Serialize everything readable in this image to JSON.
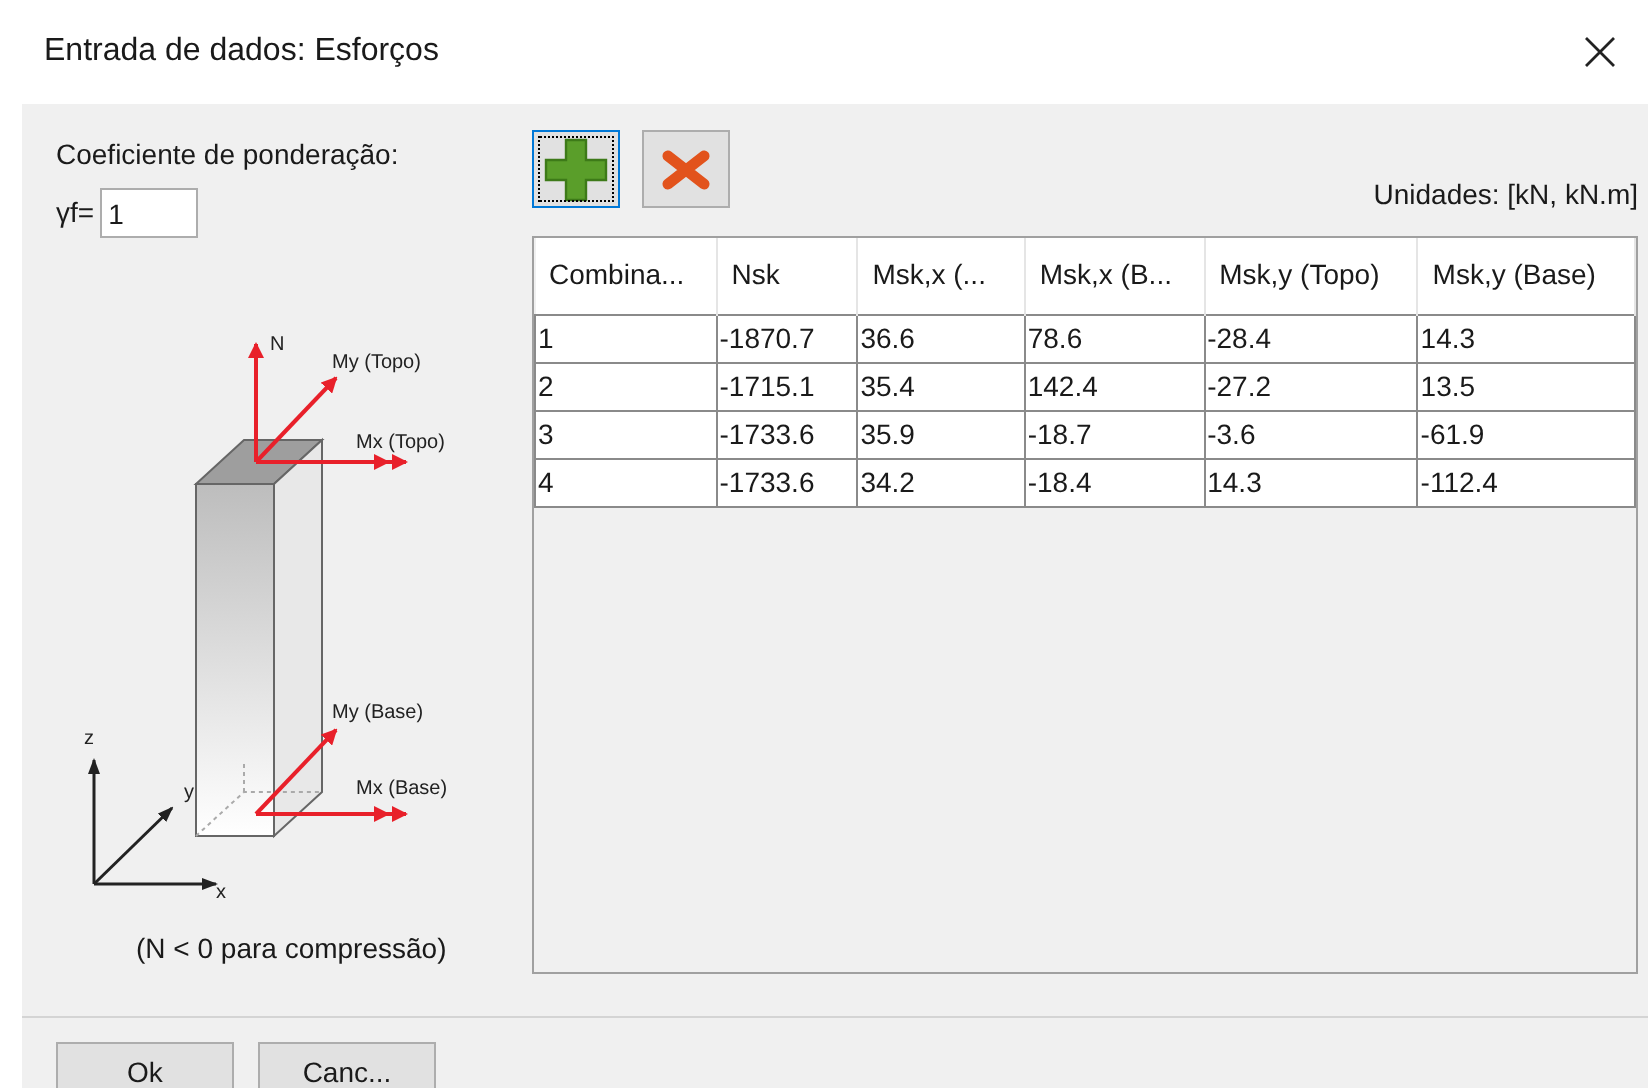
{
  "window": {
    "title": "Entrada de dados: Esforços"
  },
  "weighting": {
    "label": "Coeficiente de ponderação:",
    "field_label": "γf=",
    "value": "1"
  },
  "diagram": {
    "labels": [
      "N",
      "My (Topo)",
      "Mx (Topo)",
      "My (Base)",
      "Mx (Base)",
      "z",
      "y",
      "x"
    ],
    "note": "(N < 0 para compressão)"
  },
  "toolbar": [
    {
      "kind": "add",
      "focused": true
    },
    {
      "kind": "delete",
      "focused": false
    }
  ],
  "units": "Unidades: [kN, kN.m]",
  "table": {
    "columns": [
      "Combina...",
      "Nsk",
      "Msk,x (...",
      "Msk,x (B...",
      "Msk,y (Topo)",
      "Msk,y (Base)"
    ],
    "rows": [
      [
        "1",
        "-1870.7",
        "36.6",
        "78.6",
        "-28.4",
        "14.3"
      ],
      [
        "2",
        "-1715.1",
        "35.4",
        "142.4",
        "-27.2",
        "13.5"
      ],
      [
        "3",
        "-1733.6",
        "35.9",
        "-18.7",
        "-3.6",
        "-61.9"
      ],
      [
        "4",
        "-1733.6",
        "34.2",
        "-18.4",
        "14.3",
        "-112.4"
      ]
    ]
  },
  "buttons": [
    "Ok",
    "Canc..."
  ]
}
